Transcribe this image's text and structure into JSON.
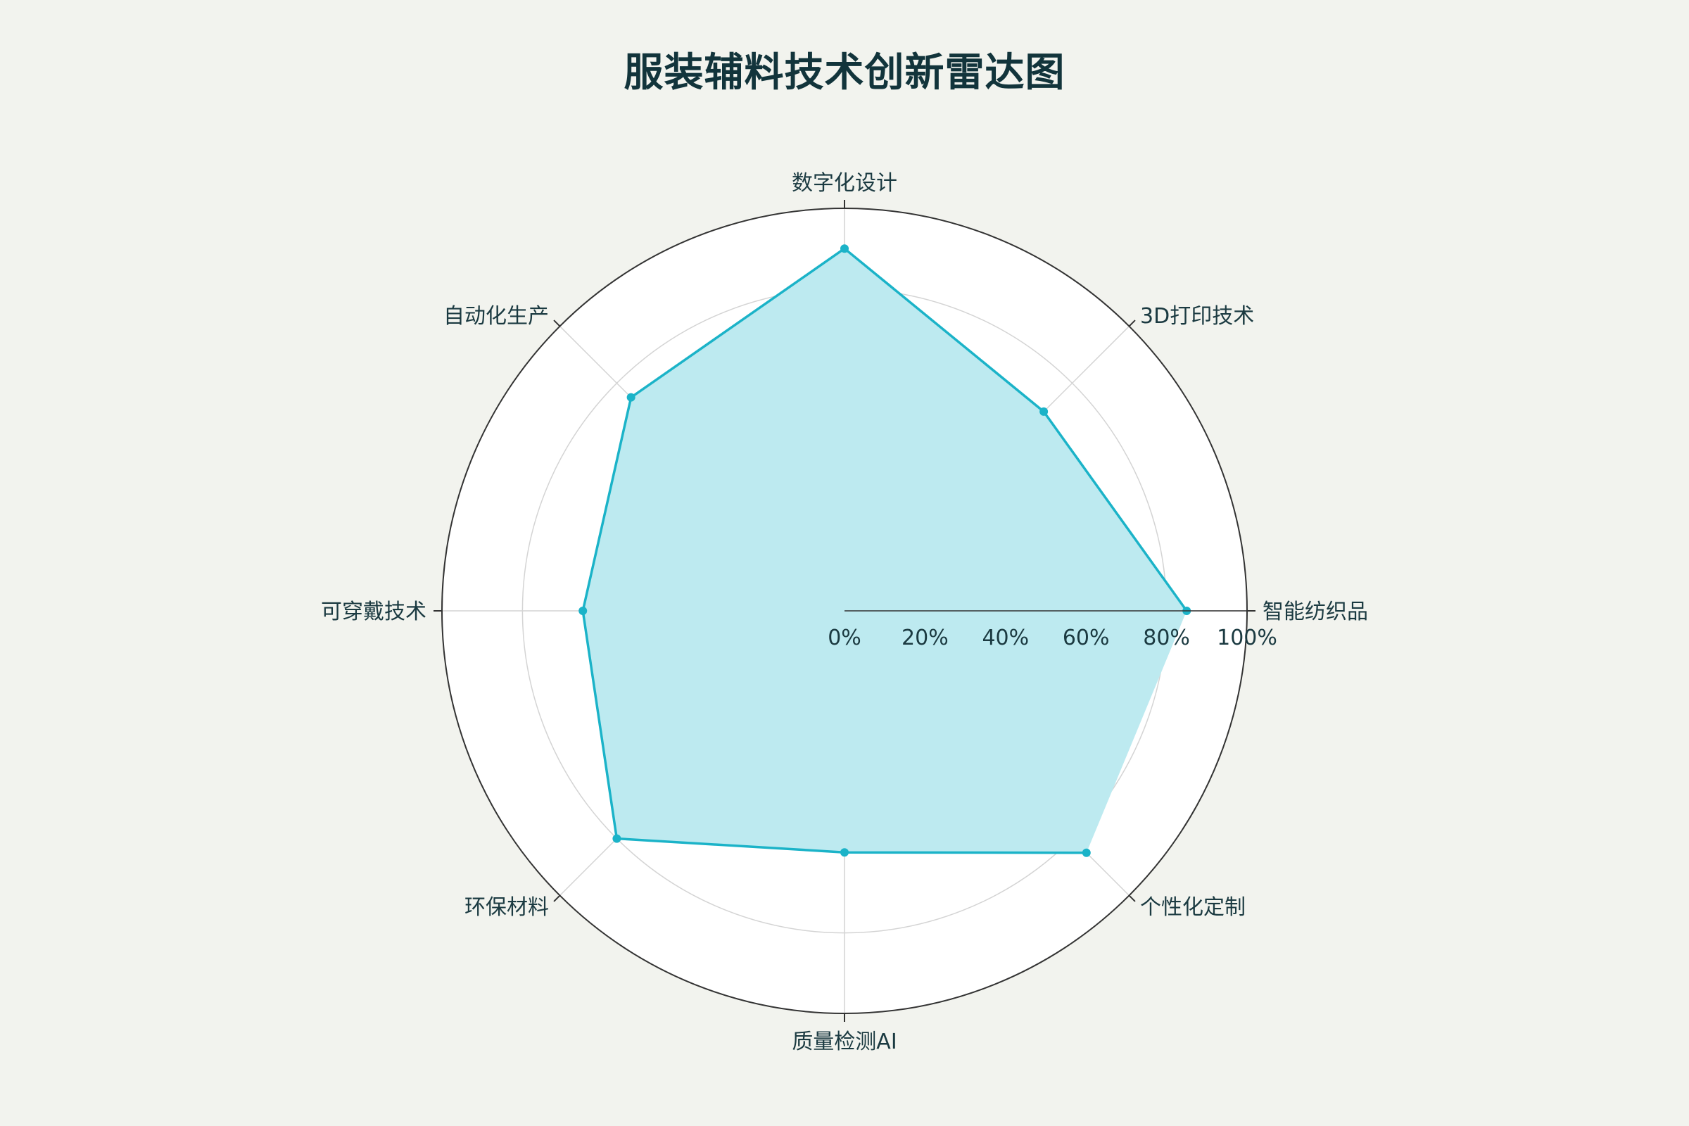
{
  "chart_data": {
    "type": "radar",
    "title": "服装辅料技术创新雷达图",
    "categories": [
      "智能纺织品",
      "3D打印技术",
      "数字化设计",
      "自动化生产",
      "可穿戴技术",
      "环保材料",
      "质量检测AI",
      "个性化定制"
    ],
    "series": [
      {
        "values": [
          85,
          70,
          90,
          75,
          65,
          80,
          60,
          85
        ]
      }
    ],
    "radial_range": [
      0,
      100
    ],
    "radial_ticks": [
      0,
      20,
      40,
      60,
      80,
      100
    ],
    "radial_tick_labels": [
      "0%",
      "20%",
      "40%",
      "60%",
      "80%",
      "100%"
    ],
    "grid": true,
    "legend": false
  },
  "colors": {
    "background": "#f2f3ee",
    "plot_background": "#ffffff",
    "series_line": "#1bb3c8",
    "series_fill": "#bdeaf0",
    "grid": "#d4d4d4",
    "outer_ring": "#333333",
    "text": "#1b3a41"
  }
}
